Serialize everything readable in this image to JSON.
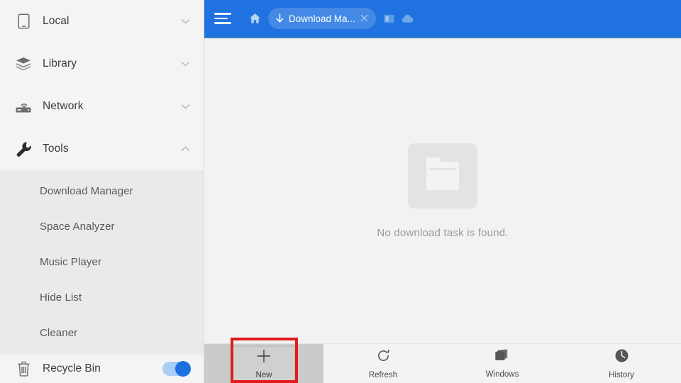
{
  "sidebar": {
    "items": [
      {
        "label": "Local",
        "icon": "phone-icon",
        "chevron": "chevron-down-icon",
        "expanded": false
      },
      {
        "label": "Library",
        "icon": "layers-icon",
        "chevron": "chevron-down-icon",
        "expanded": false
      },
      {
        "label": "Network",
        "icon": "router-icon",
        "chevron": "chevron-down-icon",
        "expanded": false
      },
      {
        "label": "Tools",
        "icon": "wrench-icon",
        "chevron": "chevron-up-icon",
        "expanded": true
      }
    ],
    "tools_subitems": [
      {
        "label": "Download Manager"
      },
      {
        "label": "Space Analyzer"
      },
      {
        "label": "Music Player"
      },
      {
        "label": "Hide List"
      },
      {
        "label": "Cleaner"
      }
    ],
    "recycle_bin": {
      "label": "Recycle Bin",
      "icon": "trash-icon",
      "toggle_on": true
    }
  },
  "topbar": {
    "menu_icon": "hamburger-icon",
    "home_icon": "home-icon",
    "tab": {
      "icon": "download-arrow-icon",
      "title": "Download Ma...",
      "close_icon": "close-icon"
    },
    "right_icons": [
      {
        "name": "window-icon"
      },
      {
        "name": "cloud-icon"
      }
    ],
    "background_color": "#1f72e0"
  },
  "content": {
    "empty_icon": "empty-folder-icon",
    "empty_message": "No download task is found."
  },
  "bottombar": {
    "new": {
      "label": "New",
      "icon": "plus-icon",
      "highlighted": true
    },
    "buttons": [
      {
        "label": "Refresh",
        "icon": "refresh-icon"
      },
      {
        "label": "Windows",
        "icon": "windows-stack-icon"
      },
      {
        "label": "History",
        "icon": "clock-icon"
      }
    ]
  },
  "highlight": {
    "color": "#e01b1b"
  }
}
